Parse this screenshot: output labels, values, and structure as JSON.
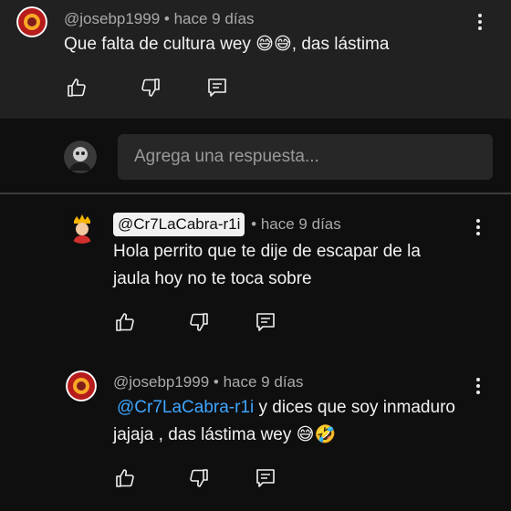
{
  "comment1": {
    "author": "@josebp1999",
    "time": "hace 9 días",
    "text": "Que falta de cultura wey 😅😅, das lástima"
  },
  "reply_input": {
    "placeholder": "Agrega una respuesta..."
  },
  "reply1": {
    "author": "@Cr7LaCabra-r1i",
    "time": "hace 9 días",
    "line1": "Hola perrito que te dije de escapar de la",
    "line2": "jaula hoy no te toca sobre"
  },
  "reply2": {
    "author": "@josebp1999",
    "time": "hace 9 días",
    "mention": "@Cr7LaCabra-r1i",
    "line1_rest": "y dices que soy inmaduro",
    "line2": "jajaja , das lástima wey 😅🤣"
  },
  "separator": "•",
  "icons": [
    "like-icon",
    "dislike-icon",
    "reply-icon",
    "more-vert-icon"
  ],
  "colors": {
    "background": "#0f0f0f",
    "highlight": "#212121",
    "mention_link": "#3ea6ff"
  }
}
